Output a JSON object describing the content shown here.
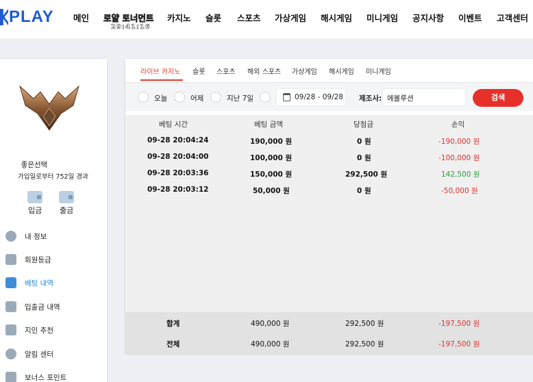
{
  "brand": {
    "logo_text": "PLAY",
    "accent": "#1e5bd6"
  },
  "nav": {
    "items": [
      "메인",
      "로얄 토너먼트",
      "카지노",
      "슬롯",
      "스포츠",
      "가상게임",
      "해시게임",
      "미니게임",
      "공지사항",
      "이벤트",
      "고객센터"
    ],
    "tournament_timer": "29:41:16"
  },
  "sidebar": {
    "username": "좋은선택",
    "since_text": "가입일로부터 752일 경과",
    "deposit_label": "입금",
    "withdraw_label": "출금",
    "menu": [
      {
        "label": "내 정보",
        "icon": "user-icon"
      },
      {
        "label": "회원등급",
        "icon": "badge-icon"
      },
      {
        "label": "베팅 내역",
        "icon": "document-icon",
        "active": true
      },
      {
        "label": "입출금 내역",
        "icon": "wallet-icon"
      },
      {
        "label": "지인 추천",
        "icon": "heart-mail-icon"
      },
      {
        "label": "알림 센터",
        "icon": "chat-icon"
      },
      {
        "label": "보너스 포인트",
        "icon": "gift-icon"
      }
    ]
  },
  "tabs": [
    "라이브 카지노",
    "슬롯",
    "스포츠",
    "해외 스포츠",
    "가상게임",
    "해시게임",
    "미니게임"
  ],
  "filters": {
    "today": "오늘",
    "yesterday": "어제",
    "last7": "지난 7일",
    "date_range": "09/28 - 09/28",
    "provider_label": "제조사:",
    "provider_value": "에볼루션",
    "search": "검색"
  },
  "table": {
    "headers": [
      "베팅 시간",
      "베팅 금액",
      "당첨금",
      "손익"
    ],
    "rows": [
      [
        "09-28 20:04:24",
        "190,000 원",
        "0 원",
        "-190,000 원"
      ],
      [
        "09-28 20:04:00",
        "100,000 원",
        "0 원",
        "-100,000 원"
      ],
      [
        "09-28 20:03:36",
        "150,000 원",
        "292,500 원",
        "142,500 원"
      ],
      [
        "09-28 20:03:12",
        "50,000 원",
        "0 원",
        "-50,000 원"
      ]
    ],
    "subtotal": [
      "합계",
      "490,000 원",
      "292,500 원",
      "-197,500 원"
    ],
    "total": [
      "전체",
      "490,000 원",
      "292,500 원",
      "-197,500 원"
    ]
  },
  "colors": {
    "negative": "#e0302a",
    "positive": "#2a9a3a",
    "active_tab": "#e03b2e",
    "search_button": "#e8302b"
  }
}
